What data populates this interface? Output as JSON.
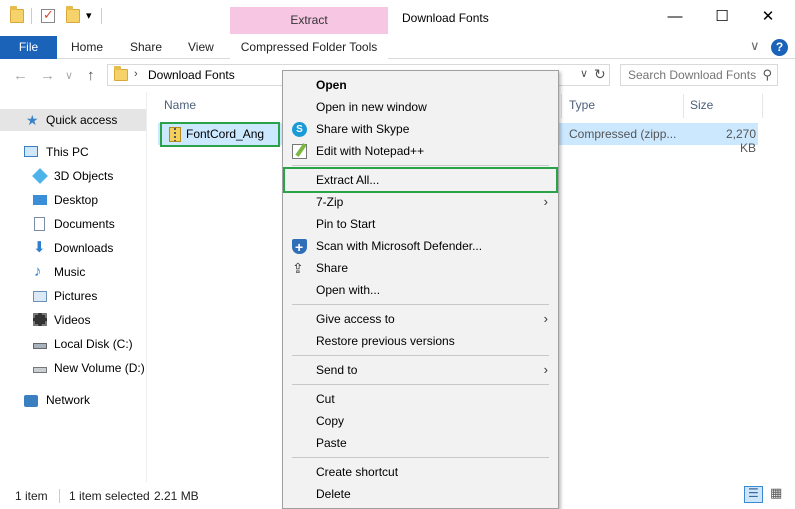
{
  "window": {
    "title": "Download Fonts",
    "context_tab_label": "Extract",
    "minimize_glyph": "—",
    "maximize_glyph": "☐",
    "close_glyph": "✕"
  },
  "quick_access_toolbar": {
    "dropdown_glyph": "▾"
  },
  "ribbon": {
    "file_tab": "File",
    "tabs": [
      "Home",
      "Share",
      "View"
    ],
    "context_tab": "Compressed Folder Tools",
    "collapse_glyph": "∨",
    "help_glyph": "?"
  },
  "address": {
    "back_glyph": "←",
    "forward_glyph": "→",
    "recent_glyph": "∨",
    "up_glyph": "↑",
    "separator": "›",
    "path": "Download Fonts",
    "dropdown_glyph": "∨",
    "refresh_glyph": "↻",
    "search_placeholder": "Search Download Fonts",
    "search_glyph": "⚲"
  },
  "navigation": {
    "quick_access": "Quick access",
    "this_pc": "This PC",
    "items": [
      "3D Objects",
      "Desktop",
      "Documents",
      "Downloads",
      "Music",
      "Pictures",
      "Videos",
      "Local Disk (C:)",
      "New Volume (D:)"
    ],
    "network": "Network"
  },
  "file_list": {
    "columns": {
      "name": "Name",
      "type": "Type",
      "size": "Size"
    },
    "rows": [
      {
        "name": "FontCord_Ang",
        "type": "Compressed (zipp...",
        "size": "2,270 KB"
      }
    ]
  },
  "status": {
    "item_count": "1 item",
    "selection": "1 item selected",
    "selection_size": "2.21 MB"
  },
  "context_menu": {
    "open": "Open",
    "open_new_window": "Open in new window",
    "share_skype": "Share with Skype",
    "edit_notepad": "Edit with Notepad++",
    "extract_all": "Extract All...",
    "seven_zip": "7-Zip",
    "pin_start": "Pin to Start",
    "scan_defender": "Scan with Microsoft Defender...",
    "share": "Share",
    "open_with": "Open with...",
    "give_access": "Give access to",
    "restore_versions": "Restore previous versions",
    "send_to": "Send to",
    "cut": "Cut",
    "copy": "Copy",
    "paste": "Paste",
    "create_shortcut": "Create shortcut",
    "delete": "Delete",
    "submenu_glyph": "›",
    "skype_glyph": "S",
    "share_glyph": "⇪"
  },
  "colors": {
    "accent_blue": "#1a63b8",
    "selection_blue": "#cce8ff",
    "highlight_green": "#2aa24a",
    "context_tab_pink": "#f7c6e3"
  }
}
